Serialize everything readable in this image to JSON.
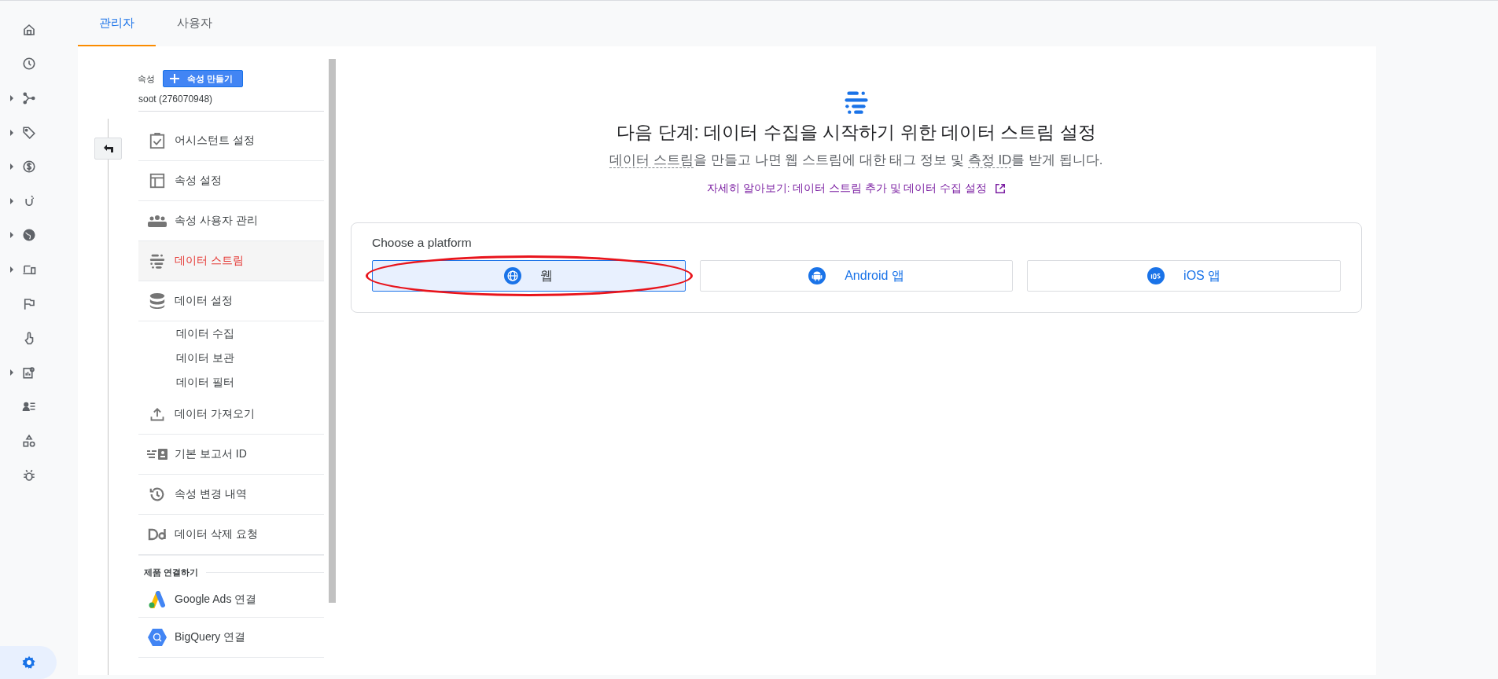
{
  "rail": {
    "items": [
      {
        "expandable": false
      },
      {
        "expandable": false
      },
      {
        "expandable": true
      },
      {
        "expandable": true
      },
      {
        "expandable": true
      },
      {
        "expandable": true
      },
      {
        "expandable": true
      },
      {
        "expandable": true
      },
      {
        "expandable": false
      },
      {
        "expandable": false
      },
      {
        "expandable": true
      },
      {
        "expandable": false
      },
      {
        "expandable": false
      },
      {
        "expandable": false
      }
    ],
    "settings": {
      "selected": true
    }
  },
  "tabs": [
    {
      "label": "관리자",
      "selected": true
    },
    {
      "label": "사용자",
      "selected": false
    }
  ],
  "property": {
    "label": "속성",
    "create_button": "속성 만들기",
    "account": "soot (276070948)"
  },
  "sidebar": {
    "items": [
      {
        "kind": "main",
        "label": "어시스턴트 설정",
        "selected": false
      },
      {
        "kind": "main",
        "label": "속성 설정",
        "selected": false
      },
      {
        "kind": "main",
        "label": "속성 사용자 관리",
        "selected": false
      },
      {
        "kind": "main",
        "label": "데이터 스트림",
        "selected": true
      },
      {
        "kind": "main",
        "label": "데이터 설정",
        "selected": false
      },
      {
        "kind": "sub",
        "label": "데이터 수집",
        "selected": false
      },
      {
        "kind": "sub",
        "label": "데이터 보관",
        "selected": false
      },
      {
        "kind": "sub",
        "label": "데이터 필터",
        "selected": false
      },
      {
        "kind": "main",
        "label": "데이터 가져오기",
        "selected": false
      },
      {
        "kind": "main",
        "label": "기본 보고서 ID",
        "selected": false
      },
      {
        "kind": "main",
        "label": "속성 변경 내역",
        "selected": false
      },
      {
        "kind": "main",
        "label": "데이터 삭제 요청",
        "selected": false
      },
      {
        "kind": "heading",
        "label": "제품 연결하기"
      },
      {
        "kind": "main",
        "label": "Google Ads 연결",
        "selected": false
      },
      {
        "kind": "main",
        "label": "BigQuery 연결",
        "selected": false
      }
    ]
  },
  "main": {
    "title": "다음 단계: 데이터 수집을 시작하기 위한 데이터 스트림 설정",
    "subtitle": [
      {
        "kind": "term",
        "text": "데이터 스트림"
      },
      {
        "kind": "plain",
        "text": "을 만들고 나면 웹 스트림에 대한 태그 정보 및 "
      },
      {
        "kind": "term",
        "text": "측정 ID"
      },
      {
        "kind": "plain",
        "text": "를 받게 됩니다."
      }
    ],
    "learn_more": "자세히 알아보기: 데이터 스트림 추가 및 데이터 수집 설정",
    "platform": {
      "title": "Choose a platform",
      "options": [
        {
          "label": "웹",
          "selected": true,
          "highlighted": true
        },
        {
          "label": "Android 앱",
          "selected": false,
          "highlighted": false
        },
        {
          "label": "iOS 앱",
          "selected": false,
          "highlighted": false
        }
      ]
    }
  }
}
